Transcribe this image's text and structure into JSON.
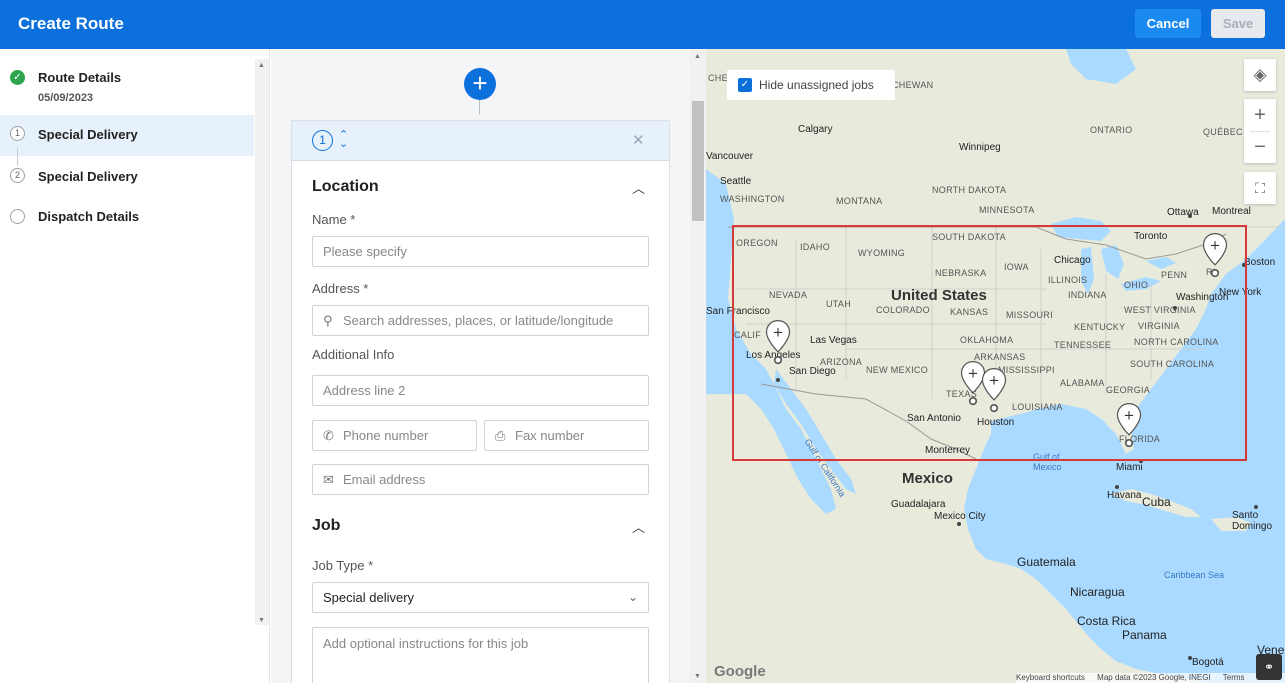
{
  "header": {
    "title": "Create Route",
    "cancel_label": "Cancel",
    "save_label": "Save"
  },
  "steps": [
    {
      "number": "✓",
      "label": "Route Details",
      "sub": "05/09/2023",
      "state": "done"
    },
    {
      "number": "1",
      "label": "Special Delivery",
      "state": "active"
    },
    {
      "number": "2",
      "label": "Special Delivery",
      "state": "pending"
    },
    {
      "number": "",
      "label": "Dispatch Details",
      "state": "pending"
    }
  ],
  "form": {
    "card_number": "1",
    "location": {
      "title": "Location",
      "name_label": "Name *",
      "name_placeholder": "Please specify",
      "address_label": "Address *",
      "address_placeholder": "Search addresses, places, or latitude/longitude",
      "additional_label": "Additional Info",
      "address2_placeholder": "Address line 2",
      "phone_placeholder": "Phone number",
      "fax_placeholder": "Fax number",
      "email_placeholder": "Email address"
    },
    "job": {
      "title": "Job",
      "type_label": "Job Type *",
      "type_value": "Special delivery",
      "instructions_placeholder": "Add optional instructions for this job"
    }
  },
  "map": {
    "hide_unassigned_label": "Hide unassigned jobs",
    "hide_unassigned_checked": true,
    "footer": {
      "shortcuts": "Keyboard shortcuts",
      "mapdata": "Map data ©2023 Google, INEGI",
      "terms": "Terms"
    },
    "google": "Google",
    "labels": {
      "country_us": "United States",
      "country_mx": "Mexico",
      "calgary": "Calgary",
      "winnipeg": "Winnipeg",
      "vancouver": "Vancouver",
      "seattle": "Seattle",
      "ottawa": "Ottawa",
      "montreal": "Montreal",
      "toronto": "Toronto",
      "chicago": "Chicago",
      "boston": "Boston",
      "newyork": "New York",
      "washington": "Washington",
      "sanfrancisco": "San Francisco",
      "lasvegas": "Las Vegas",
      "losangeles": "Los Angeles",
      "sandiego": "San Diego",
      "sanantonio": "San Antonio",
      "houston": "Houston",
      "miami": "Miami",
      "monterrey": "Monterrey",
      "havana": "Havana",
      "cuba": "Cuba",
      "guadalajara": "Guadalajara",
      "mexicocity": "Mexico City",
      "guatemala": "Guatemala",
      "nicaragua": "Nicaragua",
      "costarica": "Costa Rica",
      "panama": "Panama",
      "bogota": "Bogotá",
      "santodomingo": "Santo Domingo",
      "venez": "Venez",
      "ontario": "ONTARIO",
      "chewan": "CHEWAN",
      "montana": "MONTANA",
      "northdakota": "NORTH DAKOTA",
      "minnesota": "MINNESOTA",
      "southdakota": "SOUTH DAKOTA",
      "wyoming": "WYOMING",
      "idaho": "IDAHO",
      "oregon": "OREGON",
      "nebraska": "NEBRASKA",
      "iowa": "IOWA",
      "nevada": "NEVADA",
      "utah": "UTAH",
      "colorado": "COLORADO",
      "kansas": "KANSAS",
      "missouri": "MISSOURI",
      "illinois": "ILLINOIS",
      "indiana": "INDIANA",
      "ohio": "OHIO",
      "penn": "PENN",
      "westvirginia": "WEST VIRGINIA",
      "kentucky": "KENTUCKY",
      "virginia": "VIRGINIA",
      "tennessee": "TENNESSEE",
      "northcarolina": "NORTH CAROLINA",
      "southcarolina": "SOUTH CAROLINA",
      "arizona": "ARIZONA",
      "newmexico": "NEW MEXICO",
      "oklahoma": "OKLAHOMA",
      "arkansas": "ARKANSAS",
      "mississippi": "MISSISSIPPI",
      "alabama": "ALABAMA",
      "georgia": "GEORGIA",
      "louisiana": "LOUISIANA",
      "texas": "TEXAS",
      "florida": "FLORIDA",
      "washington_state": "WASHINGTON",
      "quebec": "QUÉBEC",
      "calif": "CALIF",
      "ri": "RI",
      "gulf_ca": "Gulf of California",
      "gulf_mx": "Gulf of Mexico",
      "caribbean": "Caribbean Sea"
    }
  }
}
